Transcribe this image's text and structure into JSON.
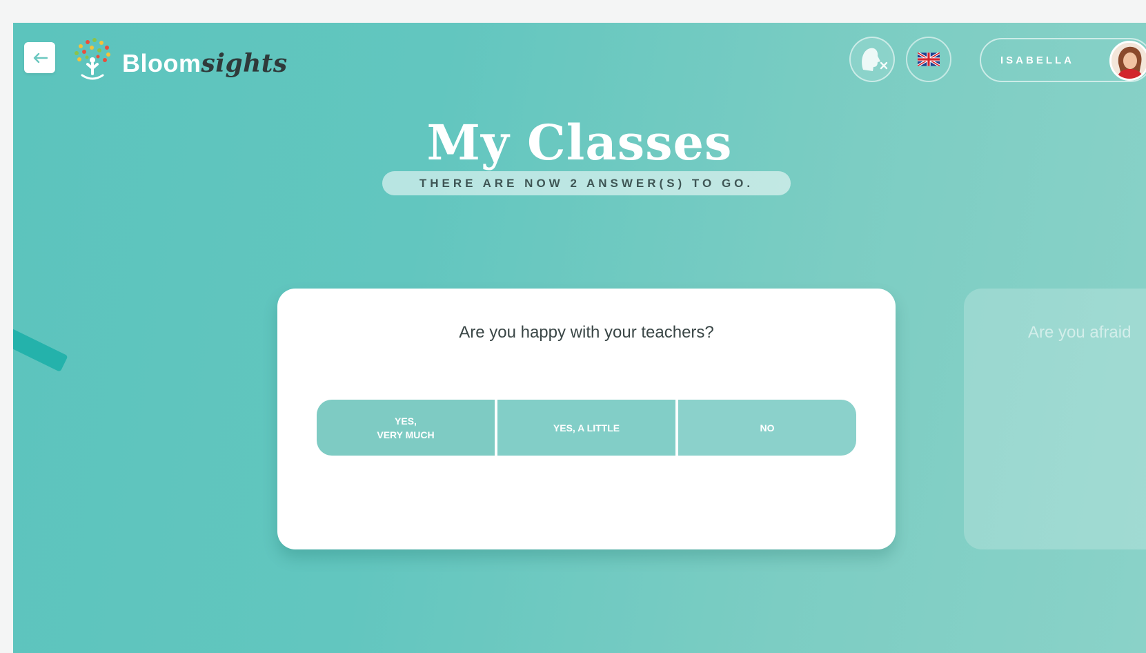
{
  "header": {
    "back_icon": "arrow-left-icon",
    "logo": {
      "part1": "Bloom",
      "part2": "sights"
    },
    "voice_icon": "voice-off-icon",
    "language_icon": "uk-flag-icon",
    "user": {
      "name": "ISABELLA",
      "avatar_icon": "user-avatar"
    }
  },
  "main": {
    "title": "My Classes",
    "subtitle": "THERE ARE NOW 2 ANSWER(S) TO GO.",
    "current_question": {
      "text": "Are you happy with your teachers?",
      "answers": [
        {
          "line1": "YES,",
          "line2": "VERY MUCH"
        },
        {
          "line1": "YES, A LITTLE",
          "line2": ""
        },
        {
          "line1": "NO",
          "line2": ""
        }
      ]
    },
    "next_question_preview": "Are you afraid"
  },
  "colors": {
    "background_start": "#5cc4bd",
    "background_end": "#8ad2c8",
    "answer_button": "#7ecbc3",
    "accent_bar": "#24b2ab"
  }
}
